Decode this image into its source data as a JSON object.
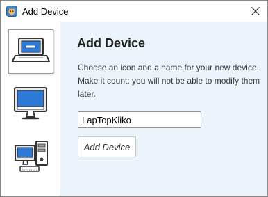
{
  "window": {
    "title": "Add Device",
    "app_icon": "app-icon",
    "close_icon": "close-icon"
  },
  "sidebar": {
    "devices": [
      {
        "icon": "laptop-icon",
        "selected": true
      },
      {
        "icon": "desktop-monitor-icon",
        "selected": false
      },
      {
        "icon": "desktop-tower-icon",
        "selected": false
      }
    ]
  },
  "main": {
    "heading": "Add Device",
    "description": "Choose an icon and a name for your new device. Make it count: you will not be able to modify them later.",
    "name_input": {
      "value": "LapTopKliko",
      "placeholder": ""
    },
    "add_button_label": "Add Device"
  },
  "colors": {
    "content_background": "#edf3fb",
    "screen_blue": "#2c79d6",
    "heading": "#222222"
  }
}
